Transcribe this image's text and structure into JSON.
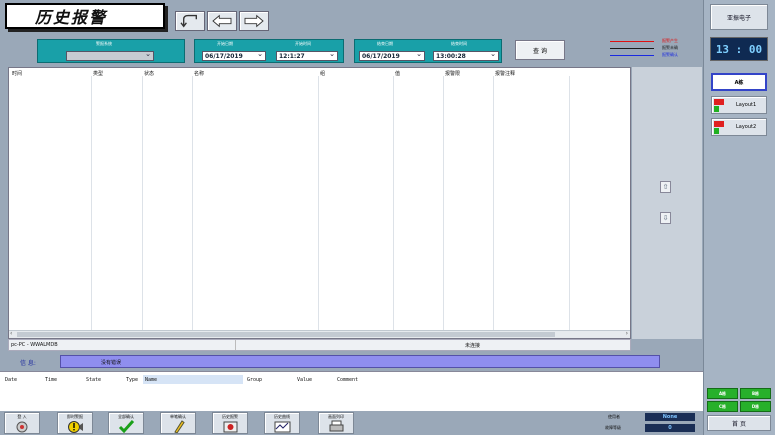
{
  "header": {
    "title": "历史报警"
  },
  "query": {
    "alarm_group": {
      "label": "警报系统",
      "value": ""
    },
    "start_date": {
      "label": "开始日期",
      "value": "06/17/2019"
    },
    "start_time": {
      "label": "开始时间",
      "value": "12:1:27"
    },
    "end_date": {
      "label": "结束日期",
      "value": "06/17/2019"
    },
    "end_time": {
      "label": "结束时间",
      "value": "13:00:28"
    },
    "query_button": "查 询"
  },
  "legend": [
    {
      "label": "报警产生",
      "color": "#e01010"
    },
    {
      "label": "报警未确",
      "color": "#1a1a1a"
    },
    {
      "label": "报警确认",
      "color": "#1a2ae0"
    }
  ],
  "table": {
    "columns": [
      "时间",
      "类型",
      "状态",
      "名称",
      "组",
      "值",
      "报警限",
      "报警注释"
    ],
    "rows": []
  },
  "status_bar": {
    "node": "pc-PC - WWALMDB",
    "connection": "未连接"
  },
  "info": {
    "label": "信 息:",
    "message": "没有错误"
  },
  "event_list": {
    "columns": [
      "Date",
      "Time",
      "State",
      "Type",
      "Name",
      "Group",
      "Value",
      "Comment"
    ]
  },
  "toolbar": [
    {
      "label": "登 入",
      "icon": "login-icon"
    },
    {
      "label": "即时警报",
      "icon": "alarm-bell-icon"
    },
    {
      "label": "全部确认",
      "icon": "check-icon"
    },
    {
      "label": "单笔确认",
      "icon": "pencil-icon"
    },
    {
      "label": "历史报警",
      "icon": "history-icon"
    },
    {
      "label": "历史曲线",
      "icon": "trend-icon"
    },
    {
      "label": "画面列印",
      "icon": "printer-icon"
    }
  ],
  "footer": {
    "user_label": "使用者",
    "user_value": "None",
    "count_label": "故障等级",
    "count_value": "0"
  },
  "sidebar": {
    "company": "亚振电子",
    "clock": "13 : 00",
    "building_label": "A栋",
    "layouts": [
      "Layout1",
      "Layout2"
    ],
    "blocks": [
      "A栋",
      "B栋",
      "C栋",
      "D栋"
    ],
    "home_button": "首 页"
  },
  "colors": {
    "accent": "#19a0a8",
    "info_bar": "#8f8eef",
    "clock_bg": "#0f2a52",
    "block_green": "#27b02b"
  }
}
